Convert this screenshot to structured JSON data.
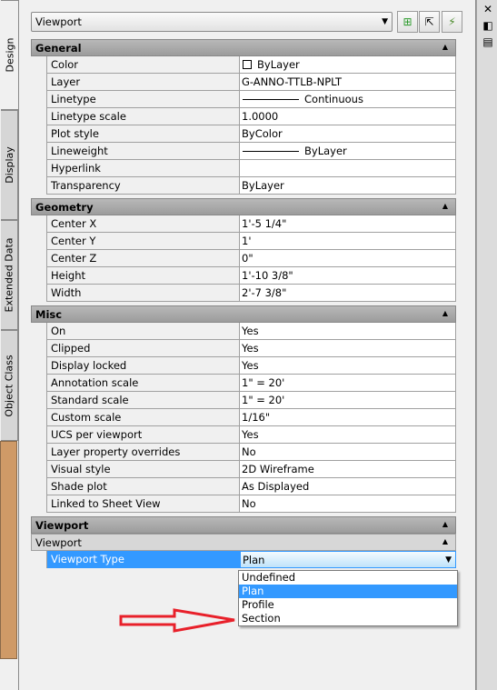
{
  "object_selector": {
    "value": "Viewport"
  },
  "toolbar": [
    {
      "icon": "add-to-selection-icon"
    },
    {
      "icon": "select-objects-icon"
    },
    {
      "icon": "quick-select-icon"
    }
  ],
  "right_bar": [
    {
      "icon": "close-icon"
    },
    {
      "icon": "auto-hide-icon"
    },
    {
      "icon": "properties-icon"
    }
  ],
  "tabs": [
    {
      "label": "Design",
      "active": true
    },
    {
      "label": "Display"
    },
    {
      "label": "Extended Data"
    },
    {
      "label": "Object Class"
    }
  ],
  "sections": {
    "general": {
      "title": "General",
      "rows": [
        {
          "name": "Color",
          "value": "ByLayer",
          "swatch": true
        },
        {
          "name": "Layer",
          "value": "G-ANNO-TTLB-NPLT"
        },
        {
          "name": "Linetype",
          "value": "Continuous",
          "line": true
        },
        {
          "name": "Linetype scale",
          "value": "1.0000"
        },
        {
          "name": "Plot style",
          "value": "ByColor"
        },
        {
          "name": "Lineweight",
          "value": "ByLayer",
          "line": true
        },
        {
          "name": "Hyperlink",
          "value": ""
        },
        {
          "name": "Transparency",
          "value": "ByLayer"
        }
      ]
    },
    "geometry": {
      "title": "Geometry",
      "rows": [
        {
          "name": "Center X",
          "value": "1'-5 1/4\""
        },
        {
          "name": "Center Y",
          "value": "1'"
        },
        {
          "name": "Center Z",
          "value": "0\""
        },
        {
          "name": "Height",
          "value": "1'-10 3/8\""
        },
        {
          "name": "Width",
          "value": "2'-7 3/8\""
        }
      ]
    },
    "misc": {
      "title": "Misc",
      "rows": [
        {
          "name": "On",
          "value": "Yes"
        },
        {
          "name": "Clipped",
          "value": "Yes"
        },
        {
          "name": "Display locked",
          "value": "Yes"
        },
        {
          "name": "Annotation scale",
          "value": "1\" = 20'"
        },
        {
          "name": "Standard scale",
          "value": "1\" = 20'"
        },
        {
          "name": "Custom scale",
          "value": "1/16\""
        },
        {
          "name": "UCS per viewport",
          "value": "Yes"
        },
        {
          "name": "Layer property overrides",
          "value": "No"
        },
        {
          "name": "Visual style",
          "value": "2D Wireframe"
        },
        {
          "name": "Shade plot",
          "value": "As Displayed"
        },
        {
          "name": "Linked to Sheet View",
          "value": "No"
        }
      ]
    },
    "viewport": {
      "title": "Viewport",
      "subtitle": "Viewport",
      "rows": [
        {
          "name": "Viewport Type",
          "value": "Plan"
        }
      ]
    }
  },
  "dropdown": {
    "options": [
      "Undefined",
      "Plan",
      "Profile",
      "Section"
    ],
    "selected": "Plan"
  },
  "annotation": {
    "arrow_color": "#e8202a"
  },
  "colors": {
    "selection": "#3399ff",
    "tan_panel": "#cf9a67"
  }
}
